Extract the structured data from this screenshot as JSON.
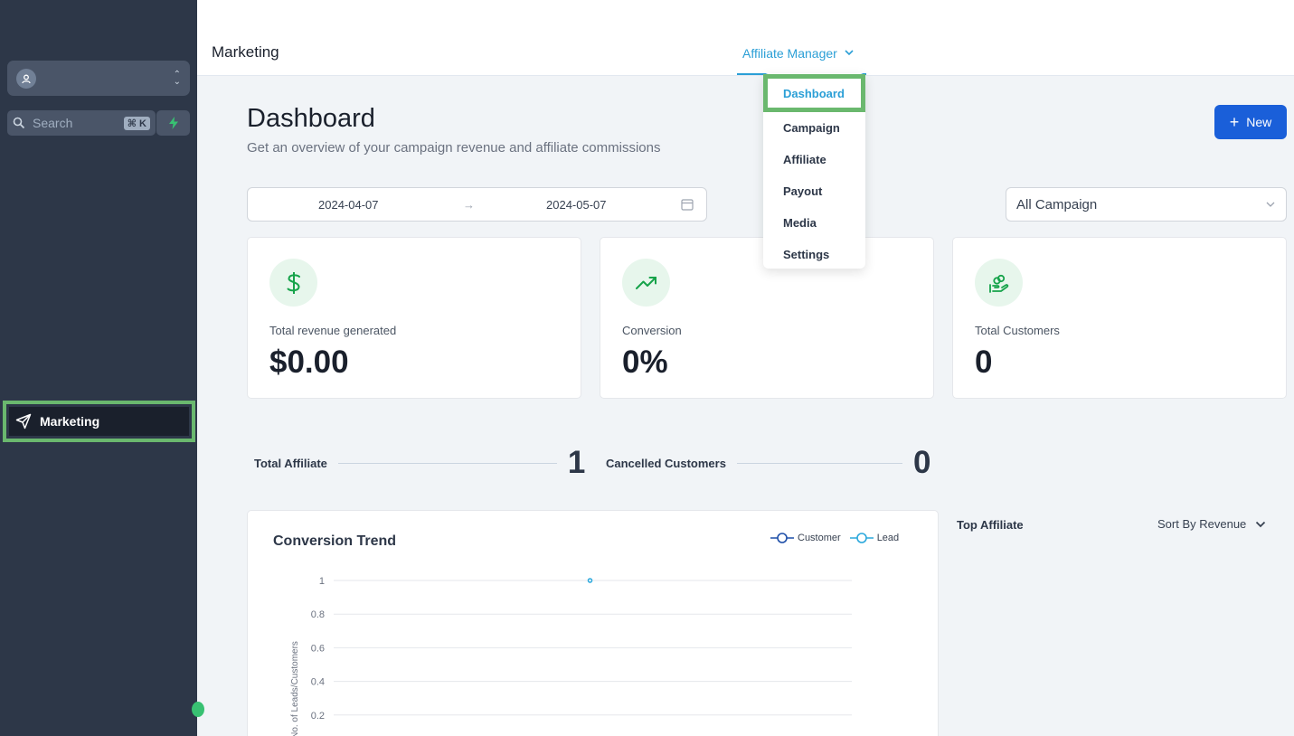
{
  "sidebar": {
    "search_placeholder": "Search",
    "search_shortcut": "⌘ K",
    "nav_items": [
      {
        "label": "Marketing",
        "icon": "send-icon",
        "active": true
      }
    ]
  },
  "header": {
    "module_title": "Marketing",
    "menu_label": "Affiliate Manager"
  },
  "dropdown": {
    "items": [
      "Dashboard",
      "Campaign",
      "Affiliate",
      "Payout",
      "Media",
      "Settings"
    ],
    "active": "Dashboard"
  },
  "page": {
    "title": "Dashboard",
    "subtitle": "Get an overview of your campaign revenue and affiliate commissions",
    "new_button": "New"
  },
  "filters": {
    "start_date": "2024-04-07",
    "end_date": "2024-05-07",
    "campaign": "All Campaign"
  },
  "cards": [
    {
      "label": "Total revenue generated",
      "value": "$0.00",
      "icon": "dollar-icon"
    },
    {
      "label": "Conversion",
      "value": "0%",
      "icon": "trending-up-icon"
    },
    {
      "label": "Total Customers",
      "value": "0",
      "icon": "hand-coins-icon"
    }
  ],
  "stats": [
    {
      "label": "Total Affiliate",
      "value": "1"
    },
    {
      "label": "Cancelled Customers",
      "value": "0"
    }
  ],
  "top_affiliate": {
    "title": "Top Affiliate",
    "sort_label": "Sort By Revenue"
  },
  "colors": {
    "sidebar_bg": "#2d3748",
    "accent": "#2b9fd6",
    "primary_button": "#1a5fd9",
    "highlight": "#6ab86e",
    "icon_green": "#16a34a",
    "customer_series": "#1e4fa8",
    "lead_series": "#2ba8dc"
  },
  "chart_data": {
    "type": "line",
    "title": "Conversion Trend",
    "ylabel": "No. of Leads/Customers",
    "xlabel": "",
    "ylim": [
      0,
      1
    ],
    "y_ticks": [
      "1",
      "0.8",
      "0.6",
      "0.4",
      "0.2"
    ],
    "legend_position": "top-right",
    "series": [
      {
        "name": "Customer",
        "values": [],
        "color": "#1e4fa8"
      },
      {
        "name": "Lead",
        "values": [
          1
        ],
        "color": "#2ba8dc"
      }
    ]
  }
}
